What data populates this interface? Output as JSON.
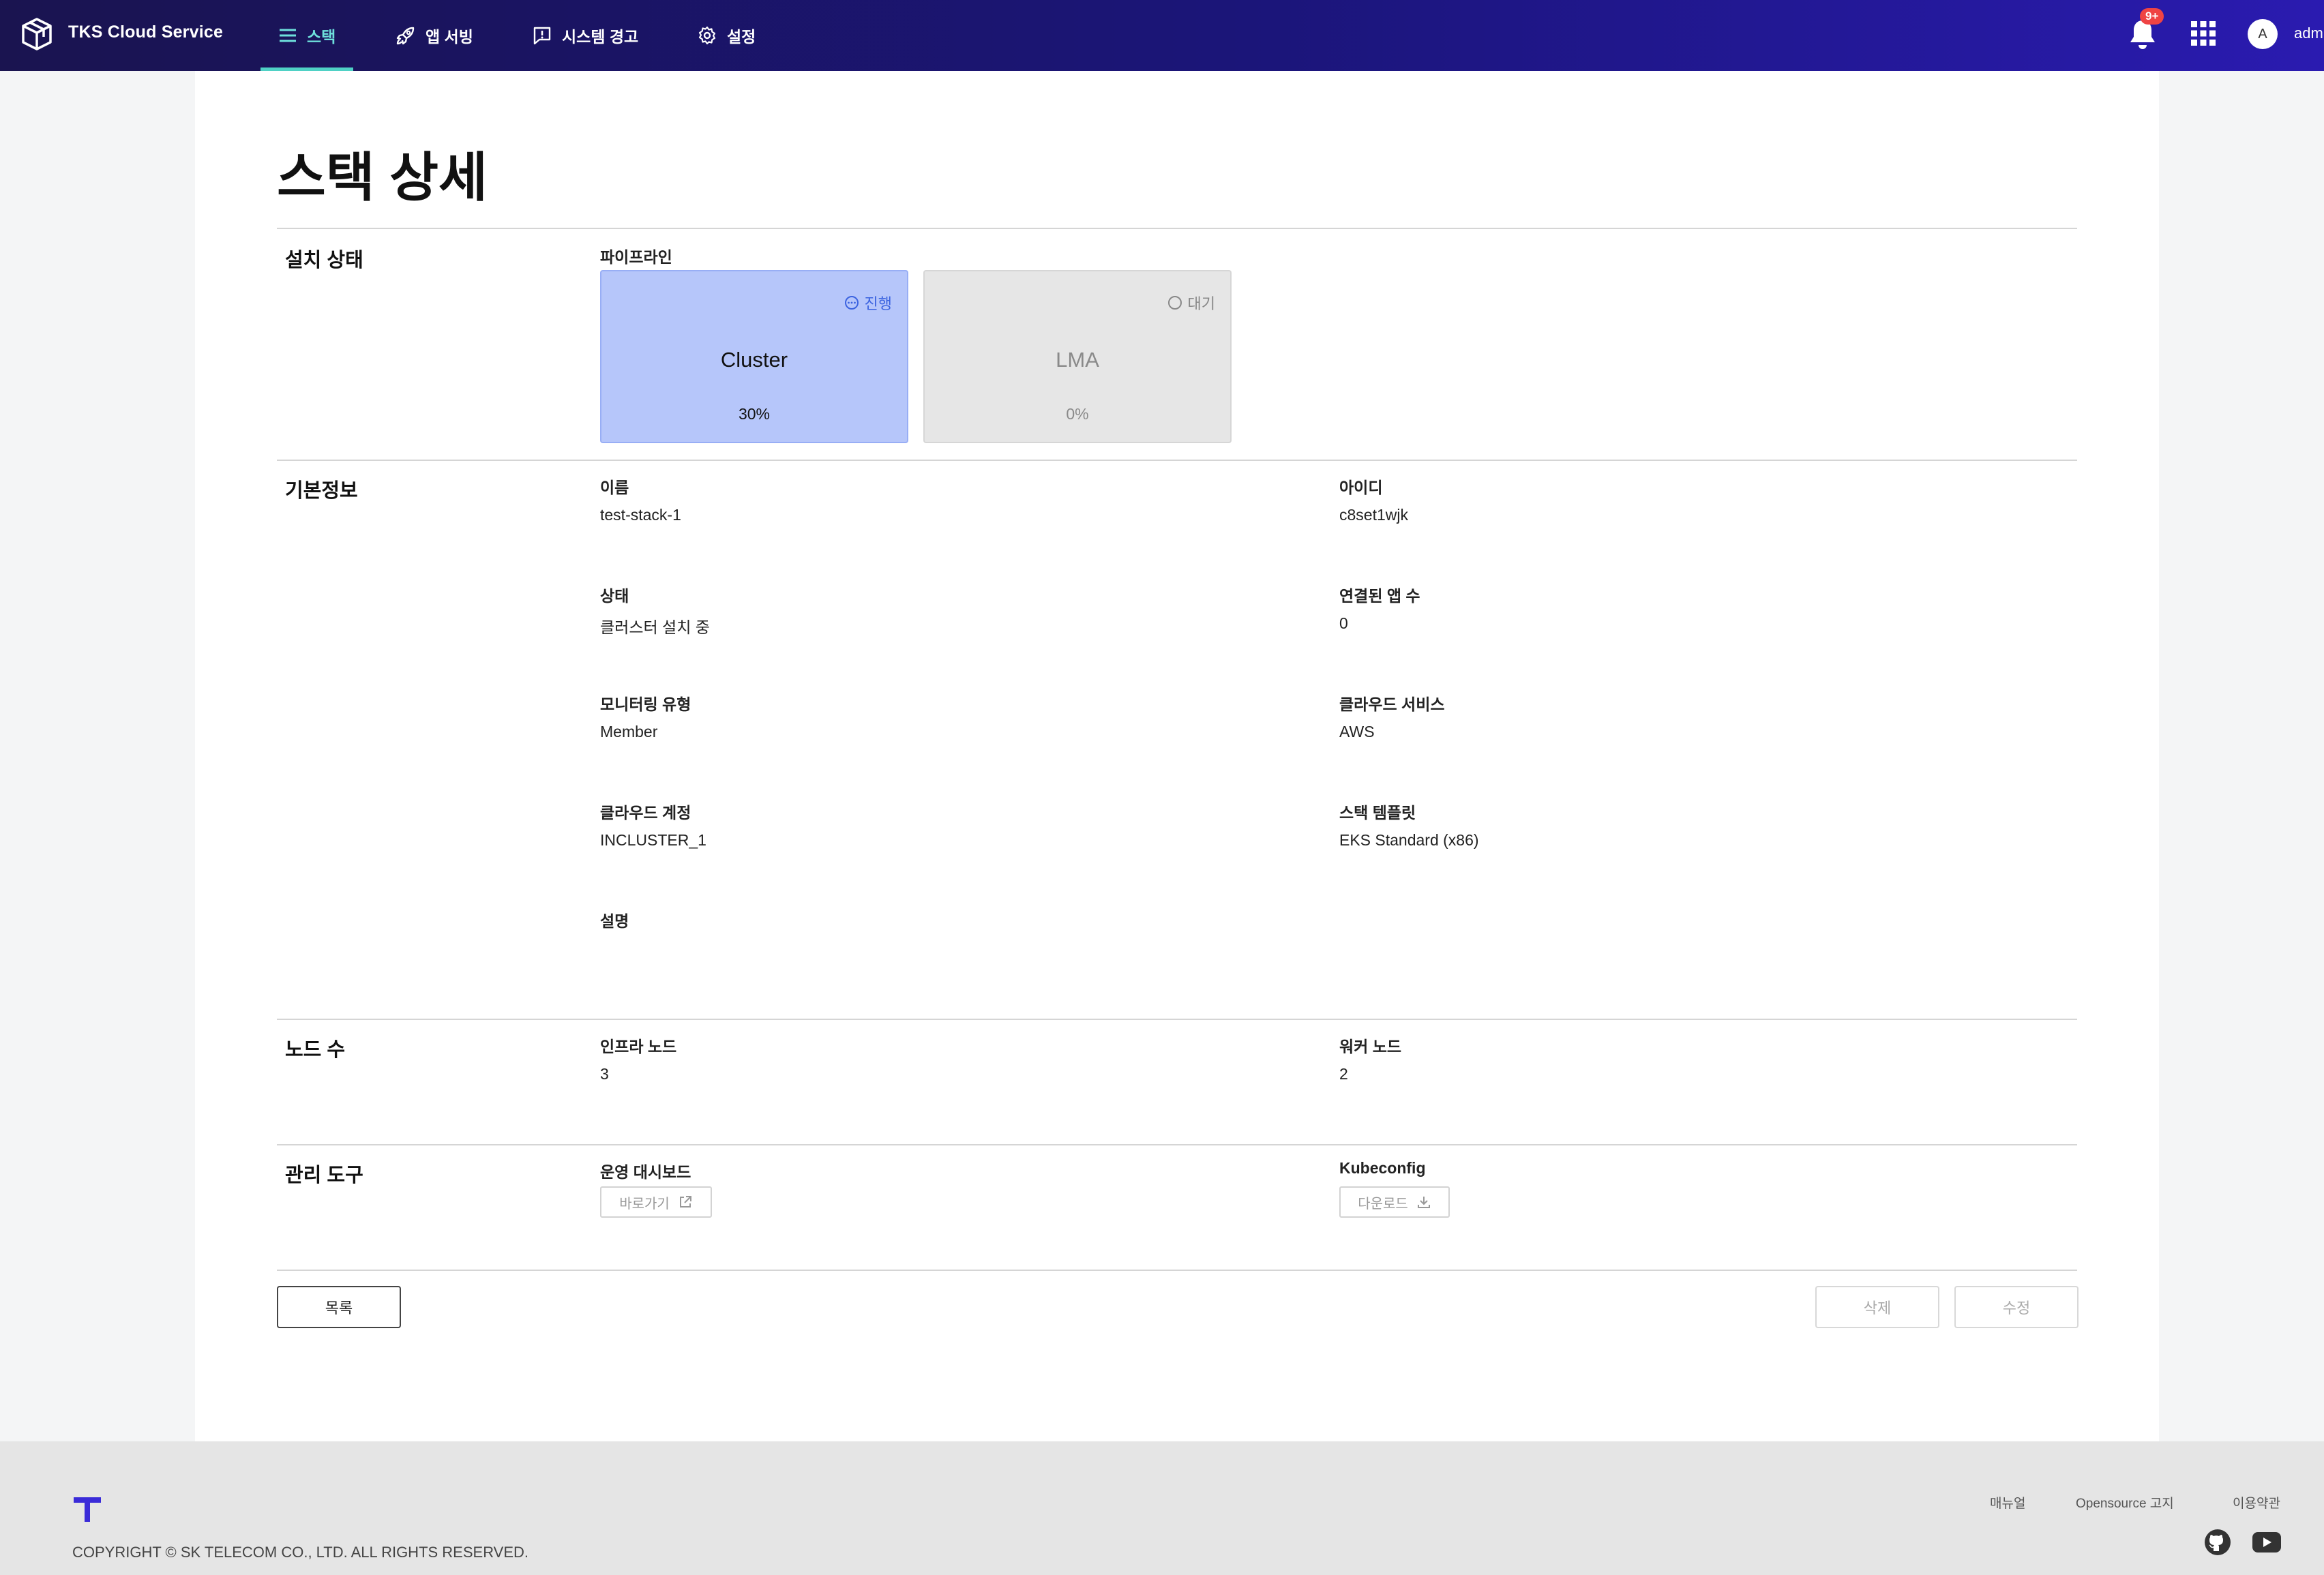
{
  "header": {
    "brand": "TKS Cloud Service",
    "nav": [
      {
        "label": "스택",
        "icon": "list-icon",
        "active": true
      },
      {
        "label": "앱 서빙",
        "icon": "rocket-icon",
        "active": false
      },
      {
        "label": "시스템 경고",
        "icon": "alert-message-icon",
        "active": false
      },
      {
        "label": "설정",
        "icon": "gear-icon",
        "active": false
      }
    ],
    "notification_badge": "9+",
    "avatar_initial": "A",
    "username": "adm"
  },
  "page": {
    "title": "스택 상세"
  },
  "install_status": {
    "section_title": "설치 상태",
    "pipeline_label": "파이프라인",
    "stages": [
      {
        "name": "Cluster",
        "status": "진행",
        "progress": "30%"
      },
      {
        "name": "LMA",
        "status": "대기",
        "progress": "0%"
      }
    ]
  },
  "basic_info": {
    "section_title": "기본정보",
    "fields": [
      {
        "label": "이름",
        "value": "test-stack-1"
      },
      {
        "label": "아이디",
        "value": "c8set1wjk"
      },
      {
        "label": "상태",
        "value": "클러스터 설치 중"
      },
      {
        "label": "연결된 앱 수",
        "value": "0"
      },
      {
        "label": "모니터링 유형",
        "value": "Member"
      },
      {
        "label": "클라우드 서비스",
        "value": "AWS"
      },
      {
        "label": "클라우드 계정",
        "value": "INCLUSTER_1"
      },
      {
        "label": "스택 템플릿",
        "value": "EKS Standard (x86)"
      },
      {
        "label": "설명",
        "value": ""
      }
    ]
  },
  "nodes": {
    "section_title": "노드 수",
    "infra_label": "인프라 노드",
    "infra_value": "3",
    "worker_label": "워커 노드",
    "worker_value": "2"
  },
  "tools": {
    "section_title": "관리 도구",
    "dashboard_label": "운영 대시보드",
    "dashboard_button": "바로가기",
    "kubeconfig_label": "Kubeconfig",
    "kubeconfig_button": "다운로드"
  },
  "actions": {
    "list": "목록",
    "delete": "삭제",
    "edit": "수정"
  },
  "footer": {
    "copyright": "COPYRIGHT © SK TELECOM CO., LTD. ALL RIGHTS RESERVED.",
    "links": [
      "매뉴얼",
      "Opensource 고지",
      "이용약관"
    ]
  },
  "colors": {
    "nav_gradient_start": "#1a1450",
    "nav_gradient_end": "#2a1bb0",
    "active_nav": "#4fd1c5",
    "cluster_card": "#b6c6fa",
    "pending_card": "#e6e6e6",
    "badge": "#ef4444"
  }
}
